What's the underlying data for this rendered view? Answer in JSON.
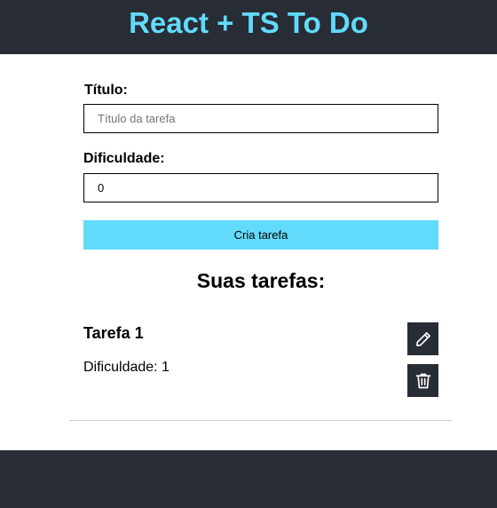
{
  "header": {
    "title": "React + TS To Do"
  },
  "form": {
    "title_label": "Título:",
    "title_placeholder": "Título da tarefa",
    "title_value": "",
    "difficulty_label": "Dificuldade:",
    "difficulty_value": "0",
    "submit_label": "Cria tarefa"
  },
  "list": {
    "heading": "Suas tarefas:",
    "tasks": [
      {
        "title": "Tarefa 1",
        "difficulty_text": "Dificuldade: 1",
        "edit_icon": "pencil-icon",
        "delete_icon": "trash-icon"
      }
    ]
  },
  "colors": {
    "dark": "#282c34",
    "accent": "#61dafb"
  }
}
